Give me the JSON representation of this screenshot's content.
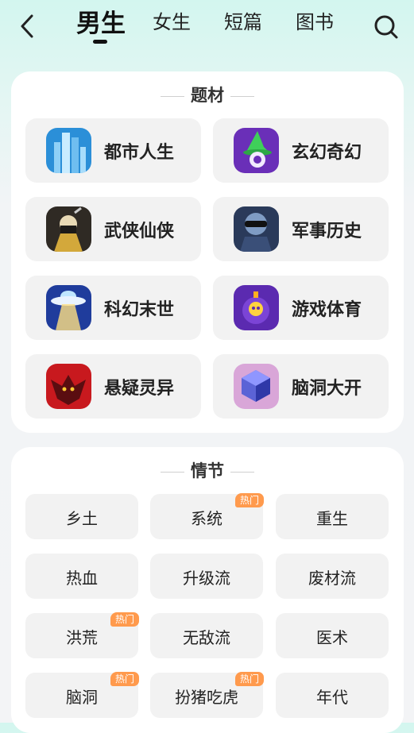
{
  "header": {
    "tabs": [
      {
        "label": "男生",
        "active": true
      },
      {
        "label": "女生",
        "active": false
      },
      {
        "label": "短篇",
        "active": false
      },
      {
        "label": "图书",
        "active": false
      }
    ],
    "back_icon": "chevron-left-icon",
    "search_icon": "search-icon"
  },
  "themes": {
    "title": "题材",
    "items": [
      {
        "label": "都市人生",
        "icon": "city-icon"
      },
      {
        "label": "玄幻奇幻",
        "icon": "witch-hat-icon"
      },
      {
        "label": "武侠仙侠",
        "icon": "swordsman-icon"
      },
      {
        "label": "军事历史",
        "icon": "soldier-icon"
      },
      {
        "label": "科幻末世",
        "icon": "ufo-icon"
      },
      {
        "label": "游戏体育",
        "icon": "skull-bomb-icon"
      },
      {
        "label": "悬疑灵异",
        "icon": "demon-icon"
      },
      {
        "label": "脑洞大开",
        "icon": "cube-icon"
      }
    ]
  },
  "plots": {
    "title": "情节",
    "badge_label": "热门",
    "items": [
      {
        "label": "乡土",
        "hot": false
      },
      {
        "label": "系统",
        "hot": true
      },
      {
        "label": "重生",
        "hot": false
      },
      {
        "label": "热血",
        "hot": false
      },
      {
        "label": "升级流",
        "hot": false
      },
      {
        "label": "废材流",
        "hot": false
      },
      {
        "label": "洪荒",
        "hot": true
      },
      {
        "label": "无敌流",
        "hot": false
      },
      {
        "label": "医术",
        "hot": false
      },
      {
        "label": "脑洞",
        "hot": true
      },
      {
        "label": "扮猪吃虎",
        "hot": true
      },
      {
        "label": "年代",
        "hot": false
      }
    ]
  },
  "colors": {
    "badge": "#ff9a4d",
    "card": "#ffffff",
    "tile": "#f2f2f2"
  }
}
